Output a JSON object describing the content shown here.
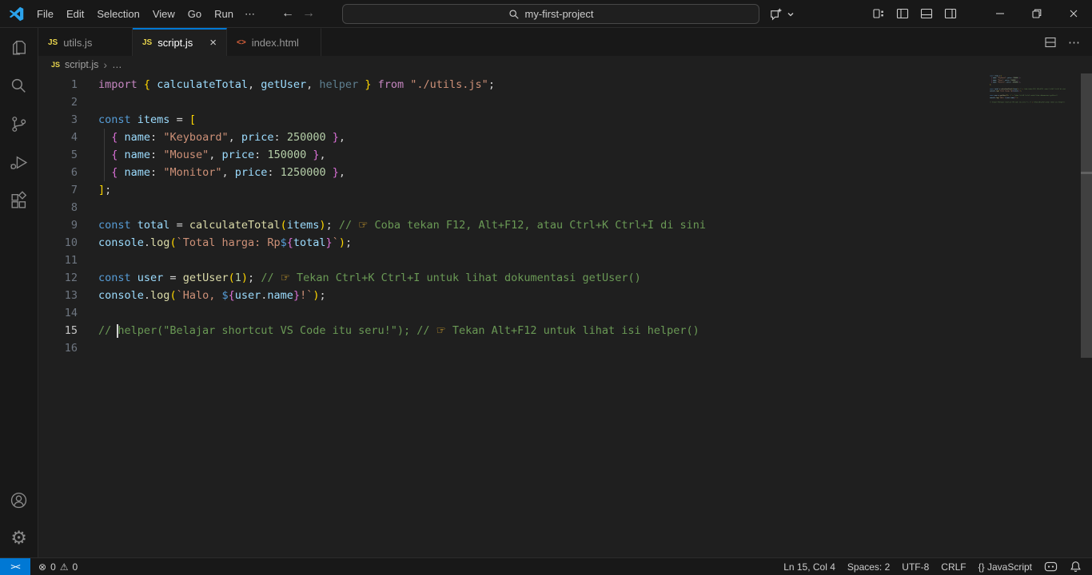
{
  "colors": {
    "accent_blue": "#0078d4",
    "editor_bg": "#1f1f1f",
    "chrome_bg": "#181818",
    "remote_bg": "#0078d4",
    "js_icon": "#e8d44d",
    "html_icon": "#e0633c"
  },
  "title_bar": {
    "menus": [
      "File",
      "Edit",
      "Selection",
      "View",
      "Go",
      "Run"
    ],
    "overflow_label": "⋯",
    "nav": {
      "back": "←",
      "forward": "→"
    },
    "command_center": {
      "value": "my-first-project",
      "icon": "search-icon"
    },
    "copilot": {
      "icon": "copilot-icon",
      "chevron": "chevron-down-icon"
    },
    "layout_controls": [
      "customize-layout-icon",
      "toggle-primary-sidebar-icon",
      "toggle-panel-icon",
      "toggle-secondary-sidebar-icon"
    ],
    "window_controls": [
      "minimize-icon",
      "restore-icon",
      "close-icon"
    ]
  },
  "activity_bar": {
    "top": [
      {
        "name": "explorer",
        "icon": "files-icon"
      },
      {
        "name": "search",
        "icon": "search-icon"
      },
      {
        "name": "source-control",
        "icon": "git-branch-icon"
      },
      {
        "name": "run-debug",
        "icon": "run-debug-icon"
      },
      {
        "name": "extensions",
        "icon": "extensions-icon"
      }
    ],
    "bottom": [
      {
        "name": "accounts",
        "icon": "account-icon"
      },
      {
        "name": "settings",
        "icon": "gear-icon"
      }
    ]
  },
  "tab_bar": {
    "tabs": [
      {
        "label": "utils.js",
        "icon": "js",
        "active": false,
        "close_icon": false
      },
      {
        "label": "script.js",
        "icon": "js",
        "active": true,
        "close_icon": true
      },
      {
        "label": "index.html",
        "icon": "html",
        "active": false,
        "close_icon": false
      }
    ],
    "close_glyph": "×",
    "actions": {
      "split_editor": "split-editor-icon",
      "more": "⋯"
    }
  },
  "breadcrumb": {
    "file_icon": "js",
    "file_icon_label": "JS",
    "file": "script.js",
    "separator": "›",
    "tail": "…"
  },
  "editor": {
    "cursor": {
      "line": 15,
      "col": 4
    },
    "lines": [
      {
        "n": 1,
        "segs": [
          [
            "import",
            "kwp"
          ],
          [
            " ",
            "pun"
          ],
          [
            "{",
            "b1"
          ],
          [
            " calculateTotal",
            "var"
          ],
          [
            ",",
            "pun"
          ],
          [
            " getUser",
            "var"
          ],
          [
            ",",
            "pun"
          ],
          [
            " helper",
            "dim"
          ],
          [
            " ",
            "pun"
          ],
          [
            "}",
            "b1"
          ],
          [
            " ",
            "pun"
          ],
          [
            "from",
            "kwp"
          ],
          [
            " ",
            "pun"
          ],
          [
            "\"./utils.js\"",
            "str"
          ],
          [
            ";",
            "pun"
          ]
        ]
      },
      {
        "n": 2,
        "segs": []
      },
      {
        "n": 3,
        "segs": [
          [
            "const",
            "kwb"
          ],
          [
            " items",
            "var"
          ],
          [
            " ",
            "pun"
          ],
          [
            "=",
            "pun"
          ],
          [
            " ",
            "pun"
          ],
          [
            "[",
            "b1"
          ]
        ]
      },
      {
        "n": 4,
        "segs": [
          [
            "  ",
            "pun"
          ],
          [
            "{",
            "b2"
          ],
          [
            " name",
            "var"
          ],
          [
            ":",
            "pun"
          ],
          [
            " ",
            "pun"
          ],
          [
            "\"Keyboard\"",
            "str"
          ],
          [
            ",",
            "pun"
          ],
          [
            " price",
            "var"
          ],
          [
            ":",
            "pun"
          ],
          [
            " ",
            "pun"
          ],
          [
            "250000",
            "num"
          ],
          [
            " ",
            "pun"
          ],
          [
            "}",
            "b2"
          ],
          [
            ",",
            "pun"
          ]
        ]
      },
      {
        "n": 5,
        "segs": [
          [
            "  ",
            "pun"
          ],
          [
            "{",
            "b2"
          ],
          [
            " name",
            "var"
          ],
          [
            ":",
            "pun"
          ],
          [
            " ",
            "pun"
          ],
          [
            "\"Mouse\"",
            "str"
          ],
          [
            ",",
            "pun"
          ],
          [
            " price",
            "var"
          ],
          [
            ":",
            "pun"
          ],
          [
            " ",
            "pun"
          ],
          [
            "150000",
            "num"
          ],
          [
            " ",
            "pun"
          ],
          [
            "}",
            "b2"
          ],
          [
            ",",
            "pun"
          ]
        ]
      },
      {
        "n": 6,
        "segs": [
          [
            "  ",
            "pun"
          ],
          [
            "{",
            "b2"
          ],
          [
            " name",
            "var"
          ],
          [
            ":",
            "pun"
          ],
          [
            " ",
            "pun"
          ],
          [
            "\"Monitor\"",
            "str"
          ],
          [
            ",",
            "pun"
          ],
          [
            " price",
            "var"
          ],
          [
            ":",
            "pun"
          ],
          [
            " ",
            "pun"
          ],
          [
            "1250000",
            "num"
          ],
          [
            " ",
            "pun"
          ],
          [
            "}",
            "b2"
          ],
          [
            ",",
            "pun"
          ]
        ]
      },
      {
        "n": 7,
        "segs": [
          [
            "]",
            "b1"
          ],
          [
            ";",
            "pun"
          ]
        ]
      },
      {
        "n": 8,
        "segs": []
      },
      {
        "n": 9,
        "segs": [
          [
            "const",
            "kwb"
          ],
          [
            " total",
            "var"
          ],
          [
            " ",
            "pun"
          ],
          [
            "=",
            "pun"
          ],
          [
            " ",
            "pun"
          ],
          [
            "calculateTotal",
            "fn"
          ],
          [
            "(",
            "b1"
          ],
          [
            "items",
            "var"
          ],
          [
            ")",
            "b1"
          ],
          [
            ";",
            "pun"
          ],
          [
            " ",
            "pun"
          ],
          [
            "// 👉 Coba tekan F12, Alt+F12, atau Ctrl+K Ctrl+I di sini",
            "com"
          ]
        ]
      },
      {
        "n": 10,
        "segs": [
          [
            "console",
            "var"
          ],
          [
            ".",
            "pun"
          ],
          [
            "log",
            "fn"
          ],
          [
            "(",
            "b1"
          ],
          [
            "`Total harga: Rp",
            "str"
          ],
          [
            "$",
            "kwb"
          ],
          [
            "{",
            "b2"
          ],
          [
            "total",
            "var"
          ],
          [
            "}",
            "b2"
          ],
          [
            "`",
            "str"
          ],
          [
            ")",
            "b1"
          ],
          [
            ";",
            "pun"
          ]
        ]
      },
      {
        "n": 11,
        "segs": []
      },
      {
        "n": 12,
        "segs": [
          [
            "const",
            "kwb"
          ],
          [
            " user",
            "var"
          ],
          [
            " ",
            "pun"
          ],
          [
            "=",
            "pun"
          ],
          [
            " ",
            "pun"
          ],
          [
            "getUser",
            "fn"
          ],
          [
            "(",
            "b1"
          ],
          [
            "1",
            "num"
          ],
          [
            ")",
            "b1"
          ],
          [
            ";",
            "pun"
          ],
          [
            " ",
            "pun"
          ],
          [
            "// 👉 Tekan Ctrl+K Ctrl+I untuk lihat dokumentasi getUser()",
            "com"
          ]
        ]
      },
      {
        "n": 13,
        "segs": [
          [
            "console",
            "var"
          ],
          [
            ".",
            "pun"
          ],
          [
            "log",
            "fn"
          ],
          [
            "(",
            "b1"
          ],
          [
            "`Halo, ",
            "str"
          ],
          [
            "$",
            "kwb"
          ],
          [
            "{",
            "b2"
          ],
          [
            "user",
            "var"
          ],
          [
            ".",
            "pun"
          ],
          [
            "name",
            "var"
          ],
          [
            "}",
            "b2"
          ],
          [
            "!`",
            "str"
          ],
          [
            ")",
            "b1"
          ],
          [
            ";",
            "pun"
          ]
        ]
      },
      {
        "n": 14,
        "segs": []
      },
      {
        "n": 15,
        "segs": [
          [
            "// ",
            "com"
          ],
          [
            "helper(\"Belajar shortcut VS Code itu seru!\"); // 👉 Tekan Alt+F12 untuk lihat isi helper()",
            "com"
          ]
        ]
      },
      {
        "n": 16,
        "segs": []
      }
    ]
  },
  "status_bar": {
    "remote_label": "><",
    "problems": {
      "error_icon": "⊗",
      "errors": "0",
      "warning_icon": "⚠",
      "warnings": "0"
    },
    "right_items": [
      {
        "name": "cursor-position",
        "label": "Ln 15, Col 4"
      },
      {
        "name": "indentation",
        "label": "Spaces: 2"
      },
      {
        "name": "encoding",
        "label": "UTF-8"
      },
      {
        "name": "eol",
        "label": "CRLF"
      },
      {
        "name": "language-mode",
        "label": "{} JavaScript"
      }
    ],
    "right_icons": [
      "copilot-status-icon",
      "bell-icon"
    ]
  }
}
